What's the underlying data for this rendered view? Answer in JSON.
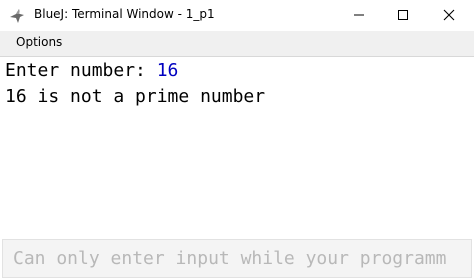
{
  "window": {
    "title": "BlueJ: Terminal Window - 1_p1",
    "icon": "bluej-bird-icon",
    "controls": [
      "minimize-icon",
      "maximize-icon",
      "close-icon"
    ]
  },
  "menu": {
    "items": [
      {
        "label": "Options"
      }
    ]
  },
  "terminal": {
    "lines": [
      {
        "prompt": "Enter number: ",
        "input": "16"
      },
      {
        "text": "16 is not a prime number"
      }
    ]
  },
  "input_area": {
    "placeholder": "Can only enter input while your programm"
  },
  "colors": {
    "user_input": "#0000c0",
    "menubar": "#f0f0f0",
    "input_area": "#f4f4f4"
  }
}
